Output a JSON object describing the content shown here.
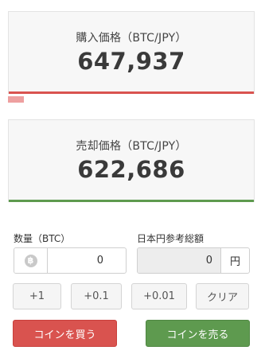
{
  "buy": {
    "label": "購入価格（BTC/JPY）",
    "price": "647,937"
  },
  "sell": {
    "label": "売却価格（BTC/JPY）",
    "price": "622,686"
  },
  "quantity": {
    "label": "数量（BTC）",
    "value": "0",
    "icon": "bitcoin-icon",
    "icon_glyph": "฿"
  },
  "jpy_total": {
    "label": "日本円参考総額",
    "value": "0",
    "unit": "円"
  },
  "steps": {
    "plus1": "+1",
    "plus01": "+0.1",
    "plus001": "+0.01",
    "clear": "クリア"
  },
  "actions": {
    "buy": "コインを買う",
    "sell": "コインを売る"
  },
  "colors": {
    "buy": "#d9534f",
    "sell": "#5e9a4f",
    "spread": "#eea0a0"
  }
}
